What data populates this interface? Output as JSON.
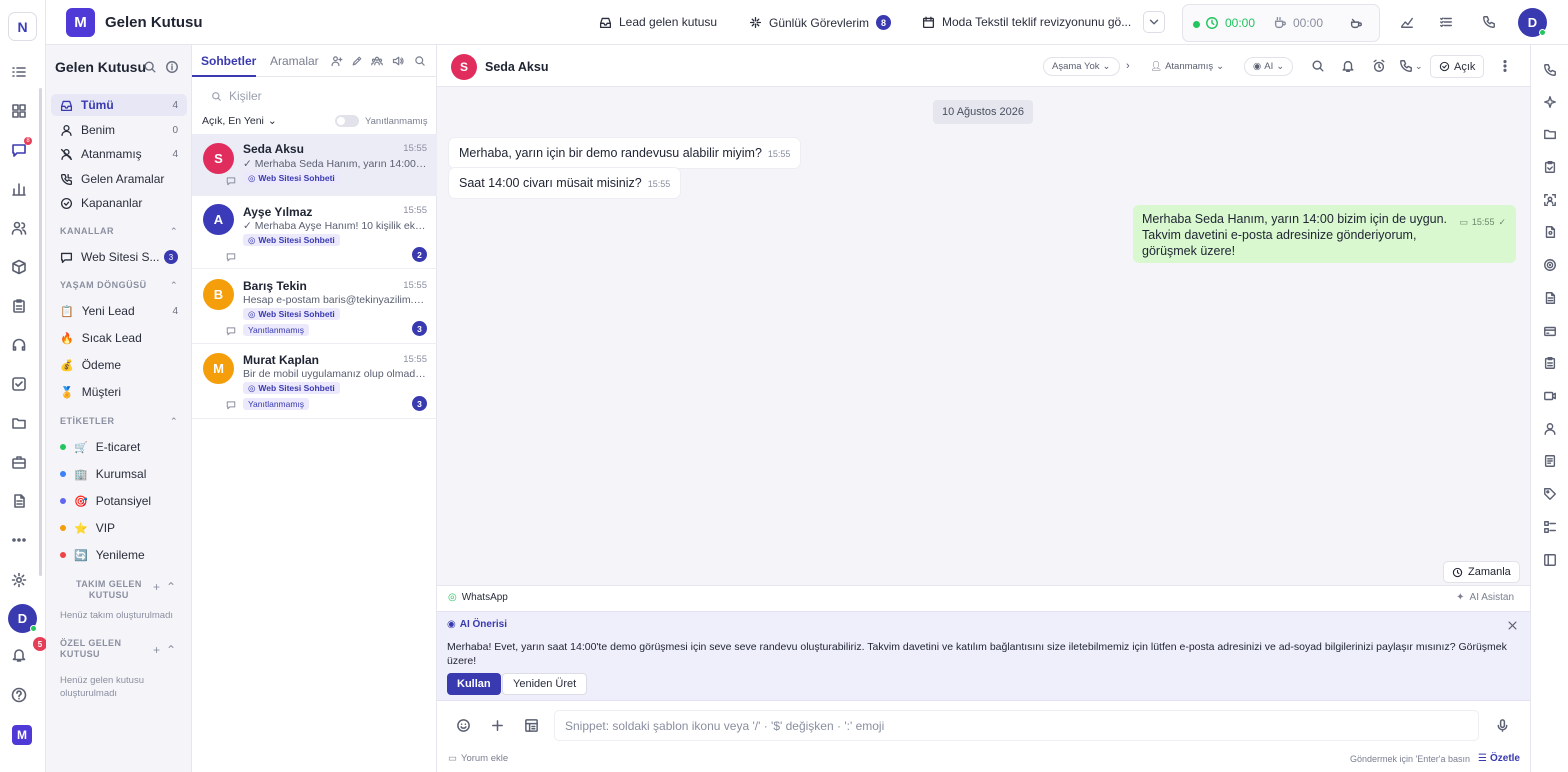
{
  "rail": {
    "workspace_initial": "N",
    "icons": [
      "list-icon",
      "dashboard-icon",
      "chat-icon",
      "chart-icon",
      "users-icon",
      "box-icon",
      "clipboard-icon",
      "headset-icon",
      "checkbox-icon",
      "folder-icon",
      "briefcase-icon",
      "document-icon",
      "more-icon",
      "settings-icon"
    ],
    "chat_badge": "8",
    "user_initial": "D",
    "notification_badge": "5",
    "brand_initial": "M"
  },
  "header": {
    "logo_initial": "M",
    "title": "Gelen Kutusu",
    "lead_inbox": "Lead gelen kutusu",
    "daily_tasks": "Günlük Görevlerim",
    "daily_tasks_count": "8",
    "meeting": "Moda Tekstil teklif revizyonunu gö...",
    "timer_active": "00:00",
    "timer_break": "00:00",
    "user_initial": "D"
  },
  "inbox": {
    "title": "Gelen Kutusu",
    "items": [
      {
        "label": "Tümü",
        "count": "4"
      },
      {
        "label": "Benim",
        "count": "0"
      },
      {
        "label": "Atanmamış",
        "count": "4"
      },
      {
        "label": "Gelen Aramalar",
        "count": ""
      },
      {
        "label": "Kapananlar",
        "count": ""
      }
    ],
    "channels_title": "KANALLAR",
    "channels": [
      {
        "label": "Web Sitesi S...",
        "count": "3"
      }
    ],
    "lifecycle_title": "YAŞAM DÖNGÜSÜ",
    "lifecycle": [
      {
        "emoji": "📋",
        "label": "Yeni Lead",
        "count": "4"
      },
      {
        "emoji": "🔥",
        "label": "Sıcak Lead",
        "count": ""
      },
      {
        "emoji": "💰",
        "label": "Ödeme",
        "count": ""
      },
      {
        "emoji": "🏅",
        "label": "Müşteri",
        "count": ""
      }
    ],
    "tags_title": "ETİKETLER",
    "tags": [
      {
        "color": "#22c55e",
        "emoji": "🛒",
        "label": "E-ticaret"
      },
      {
        "color": "#3b82f6",
        "emoji": "🏢",
        "label": "Kurumsal"
      },
      {
        "color": "#6366f1",
        "emoji": "🎯",
        "label": "Potansiyel"
      },
      {
        "color": "#f59e0b",
        "emoji": "⭐",
        "label": "VIP"
      },
      {
        "color": "#ef4444",
        "emoji": "🔄",
        "label": "Yenileme"
      }
    ],
    "team_title_1": "TAKIM GELEN",
    "team_title_2": "KUTUSU",
    "team_empty": "Henüz takım oluşturulmadı",
    "private_title_1": "ÖZEL GELEN",
    "private_title_2": "KUTUSU",
    "private_empty_1": "Henüz gelen kutusu",
    "private_empty_2": "oluşturulmadı"
  },
  "conversations": {
    "tab_chats": "Sohbetler",
    "tab_calls": "Aramalar",
    "search_placeholder": "Kişiler",
    "filter": "Açık, En Yeni",
    "unreplied_toggle": "Yanıtlanmamış",
    "items": [
      {
        "initial": "S",
        "color": "#e12d5d",
        "name": "Seda Aksu",
        "time": "15:55",
        "preview": "✓ Merhaba Seda Hanım, yarın 14:00 bizim için de uygun.",
        "channel": "Web Sitesi Sohbeti",
        "status": "",
        "unread": ""
      },
      {
        "initial": "A",
        "color": "#3b3ab8",
        "name": "Ayşe Yılmaz",
        "time": "15:55",
        "preview": "✓ Merhaba Ayşe Hanım! 10 kişilik ekibiniz için",
        "channel": "Web Sitesi Sohbeti",
        "status": "",
        "unread": "2"
      },
      {
        "initial": "B",
        "color": "#f59e0b",
        "name": "Barış Tekin",
        "time": "15:55",
        "preview": "Hesap e-postam baris@tekinyazilim.com",
        "channel": "Web Sitesi Sohbeti",
        "status": "Yanıtlanmamış",
        "unread": "3"
      },
      {
        "initial": "M",
        "color": "#f59e0b",
        "name": "Murat Kaplan",
        "time": "15:55",
        "preview": "Bir de mobil uygulamanız olup olmadığını",
        "channel": "Web Sitesi Sohbeti",
        "status": "Yanıtlanmamış",
        "unread": "3"
      }
    ]
  },
  "chat": {
    "contact_initial": "S",
    "contact_name": "Seda Aksu",
    "stage": "Aşama Yok",
    "assignee": "Atanmamış",
    "ai": "AI",
    "status": "Açık",
    "date": "10 Ağustos 2026",
    "messages": [
      {
        "text": "Merhaba, yarın için bir demo randevusu alabilir miyim?",
        "time": "15:55"
      },
      {
        "text": "Saat 14:00 civarı müsait misiniz?",
        "time": "15:55"
      }
    ],
    "outgoing": {
      "line1": "Merhaba Seda Hanım, yarın 14:00 bizim için de uygun.",
      "line2": "Takvim davetini e-posta adresinize gönderiyorum,",
      "line3": "görüşmek üzere!",
      "time": "15:55"
    },
    "schedule": "Zamanla"
  },
  "composer": {
    "channel": "WhatsApp",
    "ai_assistant": "AI Asistan",
    "ai_title": "AI Önerisi",
    "ai_text": "Merhaba! Evet, yarın saat 14:00'te demo görüşmesi için seve seve randevu oluşturabiliriz. Takvim davetini ve katılım bağlantısını size iletebilmemiz için lütfen e-posta adresinizi ve ad-soyad bilgilerinizi paylaşır mısınız? Görüşmek üzere!",
    "use": "Kullan",
    "regenerate": "Yeniden Üret",
    "placeholder": "Snippet: soldaki şablon ikonu veya '/' · '$' değişken · ':' emoji",
    "comment": "Yorum ekle",
    "send_hint": "Göndermek için 'Enter'a basın",
    "summarize": "Özetle"
  }
}
